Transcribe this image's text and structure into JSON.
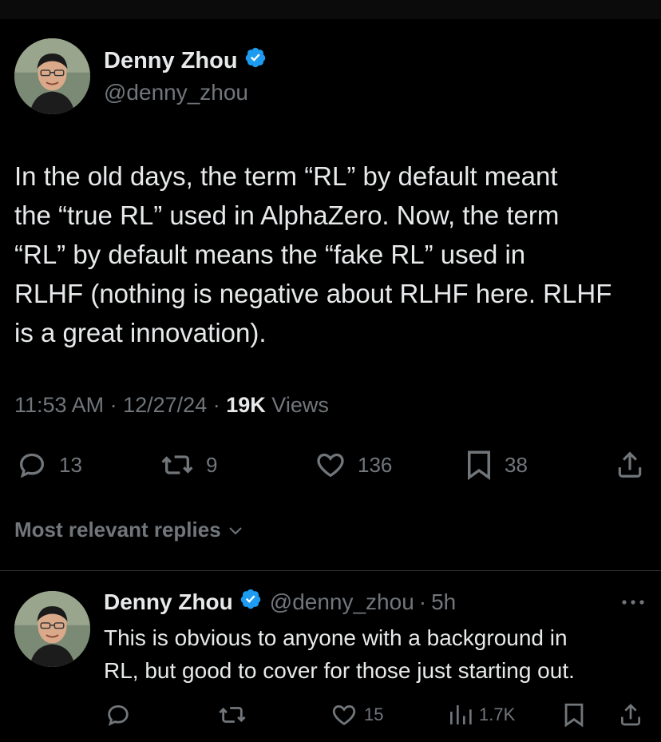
{
  "tweet": {
    "author_name": "Denny Zhou",
    "author_handle": "@denny_zhou",
    "text_lines": [
      "In the old days, the term “RL” by default meant",
      "the “true RL” used in AlphaZero. Now, the term",
      "“RL” by default means the “fake RL” used in",
      "RLHF (nothing is negative about RLHF here. RLHF",
      "is a great innovation)."
    ],
    "time": "11:53 AM",
    "date": "12/27/24",
    "views_count": "19K",
    "views_label": "Views",
    "separator": "·",
    "reply_count": "13",
    "repost_count": "9",
    "like_count": "136",
    "bookmark_count": "38"
  },
  "replies_filter": {
    "label": "Most relevant replies"
  },
  "reply": {
    "author_name": "Denny Zhou",
    "author_handle": "@denny_zhou",
    "separator": "·",
    "time_ago": "5h",
    "text_lines": [
      "This is obvious to anyone with a background in",
      "RL, but good to cover for those just starting out."
    ],
    "like_count": "15",
    "views_count": "1.7K"
  },
  "colors": {
    "background": "#000000",
    "text_primary": "#e7e9ea",
    "text_secondary": "#71767b",
    "verified_blue": "#1d9bf0",
    "divider": "#2f3336"
  },
  "icons": {
    "verified": "verified-badge-icon",
    "reply": "reply-icon",
    "repost": "repost-icon",
    "like": "heart-icon",
    "bookmark": "bookmark-icon",
    "share": "share-icon",
    "views": "views-chart-icon",
    "more": "more-dots-icon",
    "chevron": "chevron-down-icon"
  }
}
